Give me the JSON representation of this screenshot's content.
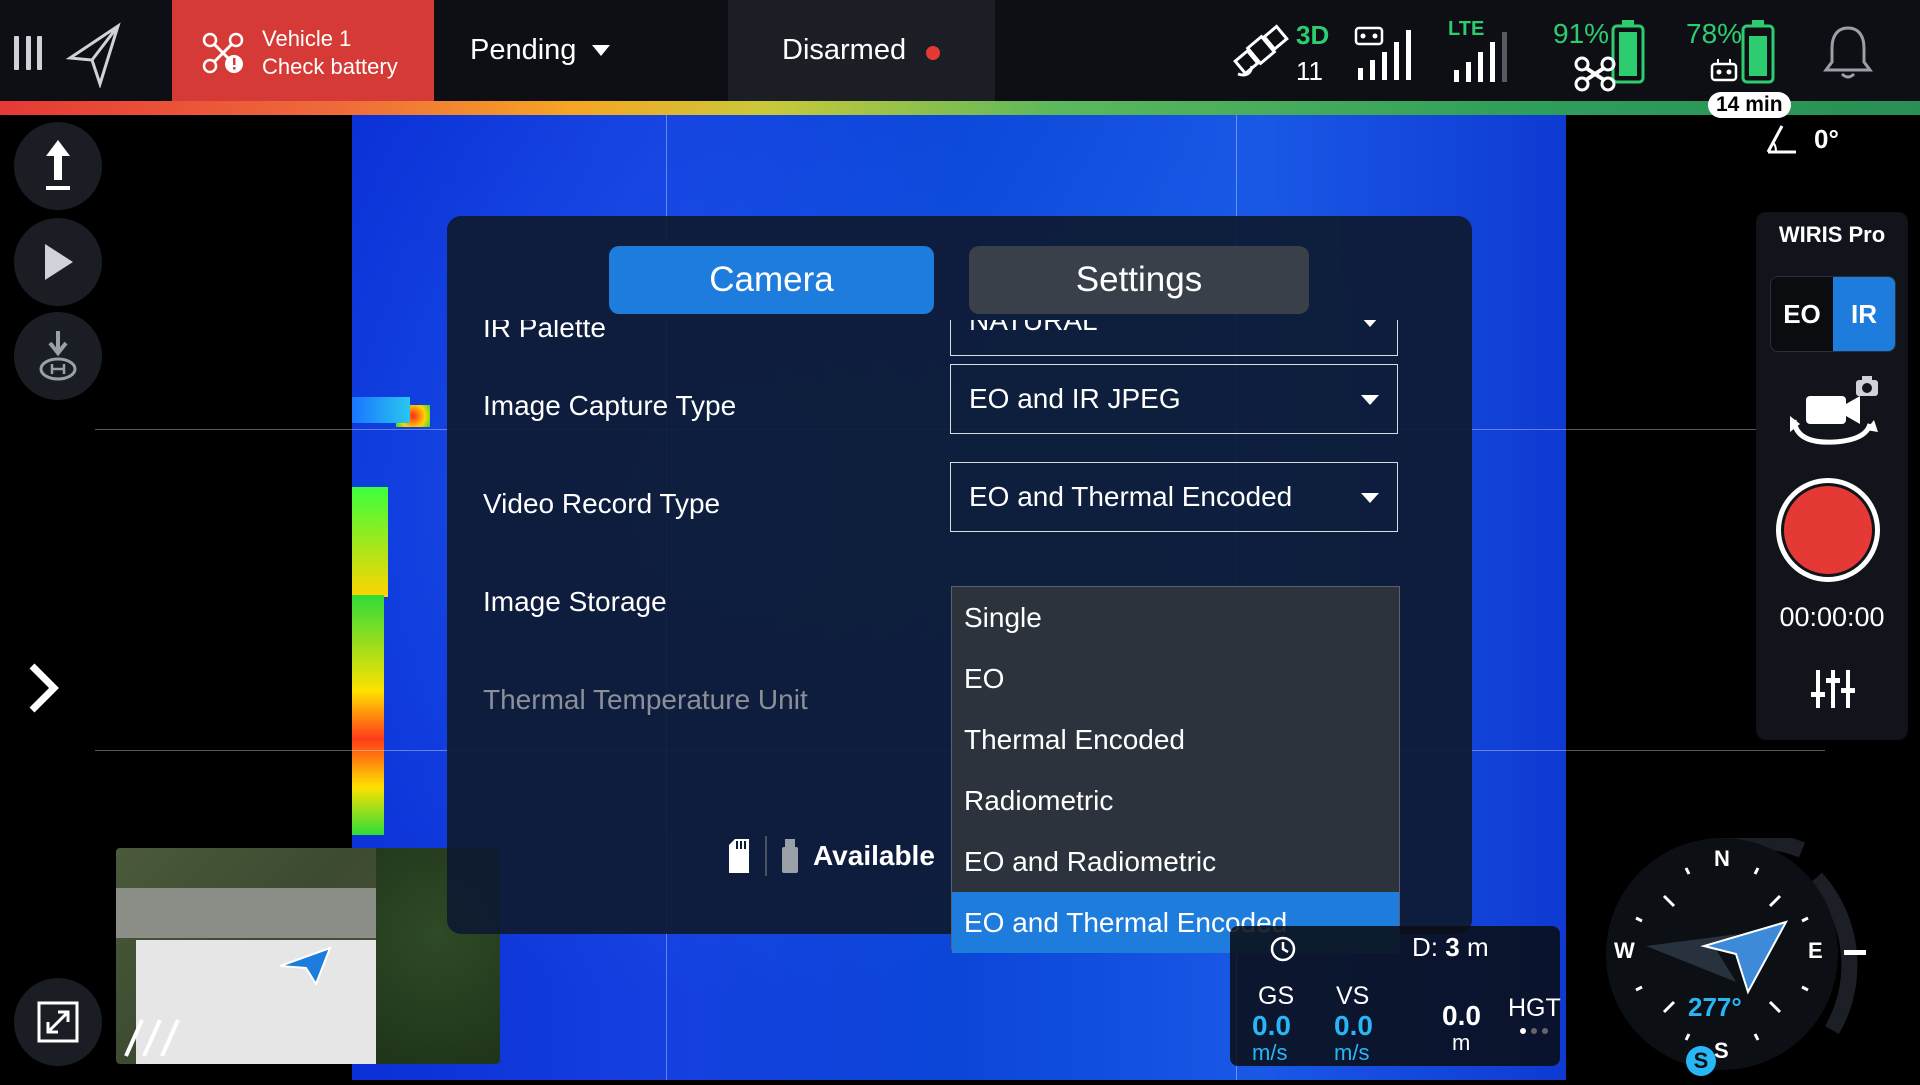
{
  "topbar": {
    "vehicle_name": "Vehicle 1",
    "vehicle_status": "Check battery",
    "mode": "Pending",
    "arm_state": "Disarmed",
    "sat_fix": "3D",
    "sat_count": "11",
    "lte_label": "LTE",
    "drone_battery": "91%",
    "rc_battery": "78%",
    "flight_time_left": "14 min"
  },
  "gimbal_tilt": "0°",
  "dialog": {
    "tabs": {
      "camera": "Camera",
      "settings": "Settings"
    },
    "rows": [
      {
        "label": "IR Palette",
        "value": "NATURAL"
      },
      {
        "label": "Image Capture Type",
        "value": "EO and IR JPEG"
      },
      {
        "label": "Video Record Type",
        "value": "EO and Thermal Encoded"
      },
      {
        "label": "Image Storage",
        "value": ""
      },
      {
        "label": "Thermal Temperature Unit",
        "value": ""
      }
    ],
    "storage_status": "Available"
  },
  "dropdown": {
    "options": [
      "Single",
      "EO",
      "Thermal Encoded",
      "Radiometric",
      "EO and Radiometric",
      "EO and Thermal Encoded"
    ],
    "selected": "EO and Thermal Encoded"
  },
  "camera_panel": {
    "title": "WIRIS Pro",
    "eo_label": "EO",
    "ir_label": "IR",
    "record_time": "00:00:00"
  },
  "telemetry": {
    "distance_label": "D:",
    "distance_value": "3",
    "distance_unit": "m",
    "gs_label": "GS",
    "gs_value": "0.0",
    "gs_unit": "m/s",
    "vs_label": "VS",
    "vs_value": "0.0",
    "vs_unit": "m/s",
    "alt_value": "0.0",
    "alt_unit": "m",
    "hgt_label": "HGT"
  },
  "compass": {
    "heading": "277°",
    "n": "N",
    "e": "E",
    "s": "S",
    "w": "W",
    "badge": "S"
  },
  "colors": {
    "accent": "#1e7ddc",
    "alert": "#d63a36",
    "ok": "#2ecc71",
    "record": "#e53935",
    "telemetry": "#29b6f6"
  }
}
